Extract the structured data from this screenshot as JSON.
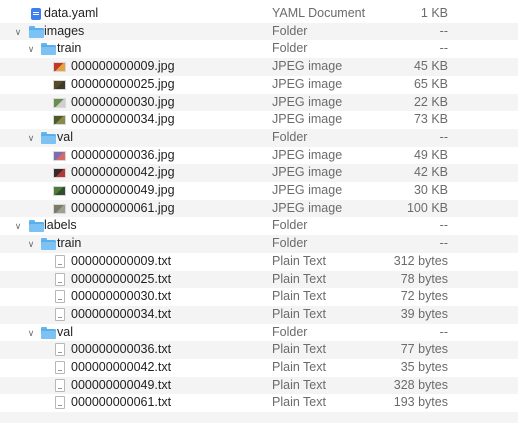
{
  "rows": [
    {
      "name": "data.yaml",
      "kind": "YAML Document",
      "size": "1 KB",
      "level": 0,
      "type": "yaml"
    },
    {
      "name": "images",
      "kind": "Folder",
      "size": "--",
      "level": 0,
      "type": "folder",
      "expanded": true
    },
    {
      "name": "train",
      "kind": "Folder",
      "size": "--",
      "level": 1,
      "type": "folder",
      "expanded": true
    },
    {
      "name": "000000000009.jpg",
      "kind": "JPEG image",
      "size": "45 KB",
      "level": 2,
      "type": "image",
      "thumb": [
        "#c0392b",
        "#e6a23c"
      ]
    },
    {
      "name": "000000000025.jpg",
      "kind": "JPEG image",
      "size": "65 KB",
      "level": 2,
      "type": "image",
      "thumb": [
        "#5a4a2a",
        "#3b3b2b"
      ]
    },
    {
      "name": "000000000030.jpg",
      "kind": "JPEG image",
      "size": "22 KB",
      "level": 2,
      "type": "image",
      "thumb": [
        "#6b8e4e",
        "#cfcfcf"
      ]
    },
    {
      "name": "000000000034.jpg",
      "kind": "JPEG image",
      "size": "73 KB",
      "level": 2,
      "type": "image",
      "thumb": [
        "#4d5a2d",
        "#8a8a4a"
      ]
    },
    {
      "name": "val",
      "kind": "Folder",
      "size": "--",
      "level": 1,
      "type": "folder",
      "expanded": true
    },
    {
      "name": "000000000036.jpg",
      "kind": "JPEG image",
      "size": "49 KB",
      "level": 2,
      "type": "image",
      "thumb": [
        "#7b6fb0",
        "#d46a6a"
      ]
    },
    {
      "name": "000000000042.jpg",
      "kind": "JPEG image",
      "size": "42 KB",
      "level": 2,
      "type": "image",
      "thumb": [
        "#3a2a2a",
        "#b03a3a"
      ]
    },
    {
      "name": "000000000049.jpg",
      "kind": "JPEG image",
      "size": "30 KB",
      "level": 2,
      "type": "image",
      "thumb": [
        "#4e7a3a",
        "#2f4f2f"
      ]
    },
    {
      "name": "000000000061.jpg",
      "kind": "JPEG image",
      "size": "100 KB",
      "level": 2,
      "type": "image",
      "thumb": [
        "#7a7a6a",
        "#a0a090"
      ]
    },
    {
      "name": "labels",
      "kind": "Folder",
      "size": "--",
      "level": 0,
      "type": "folder",
      "expanded": true
    },
    {
      "name": "train",
      "kind": "Folder",
      "size": "--",
      "level": 1,
      "type": "folder",
      "expanded": true
    },
    {
      "name": "000000000009.txt",
      "kind": "Plain Text",
      "size": "312 bytes",
      "level": 2,
      "type": "text"
    },
    {
      "name": "000000000025.txt",
      "kind": "Plain Text",
      "size": "78 bytes",
      "level": 2,
      "type": "text"
    },
    {
      "name": "000000000030.txt",
      "kind": "Plain Text",
      "size": "72 bytes",
      "level": 2,
      "type": "text"
    },
    {
      "name": "000000000034.txt",
      "kind": "Plain Text",
      "size": "39 bytes",
      "level": 2,
      "type": "text"
    },
    {
      "name": "val",
      "kind": "Folder",
      "size": "--",
      "level": 1,
      "type": "folder",
      "expanded": true
    },
    {
      "name": "000000000036.txt",
      "kind": "Plain Text",
      "size": "77 bytes",
      "level": 2,
      "type": "text"
    },
    {
      "name": "000000000042.txt",
      "kind": "Plain Text",
      "size": "35 bytes",
      "level": 2,
      "type": "text"
    },
    {
      "name": "000000000049.txt",
      "kind": "Plain Text",
      "size": "328 bytes",
      "level": 2,
      "type": "text"
    },
    {
      "name": "000000000061.txt",
      "kind": "Plain Text",
      "size": "193 bytes",
      "level": 2,
      "type": "text"
    }
  ]
}
